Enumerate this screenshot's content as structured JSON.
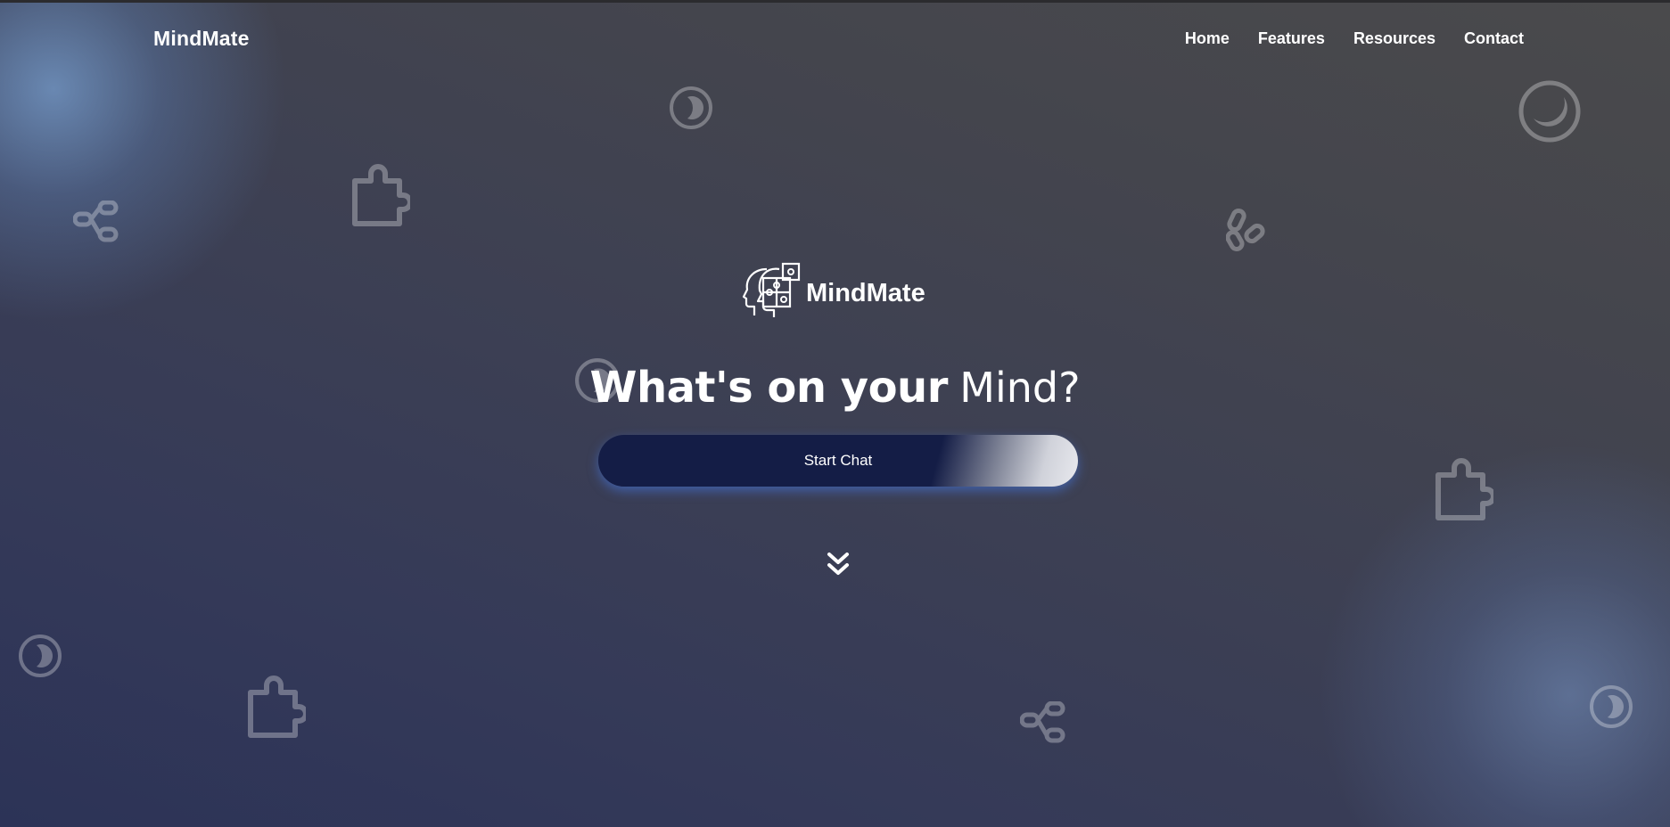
{
  "header": {
    "brand": "MindMate",
    "nav": [
      {
        "label": "Home"
      },
      {
        "label": "Features"
      },
      {
        "label": "Resources"
      },
      {
        "label": "Contact"
      }
    ]
  },
  "hero": {
    "logo_icon": "head-puzzle-icon",
    "logo_text": "MindMate",
    "headline_bold": "What's on your",
    "headline_light": "Mind?",
    "cta_label": "Start Chat",
    "scroll_icon": "double-chevron-down-icon"
  },
  "background_icons": [
    "moon-icon",
    "puzzle-icon",
    "nodes-icon",
    "link-icon"
  ],
  "colors": {
    "button_navy": "#141d46",
    "button_glow": "#4678e6",
    "text": "#ffffff"
  }
}
